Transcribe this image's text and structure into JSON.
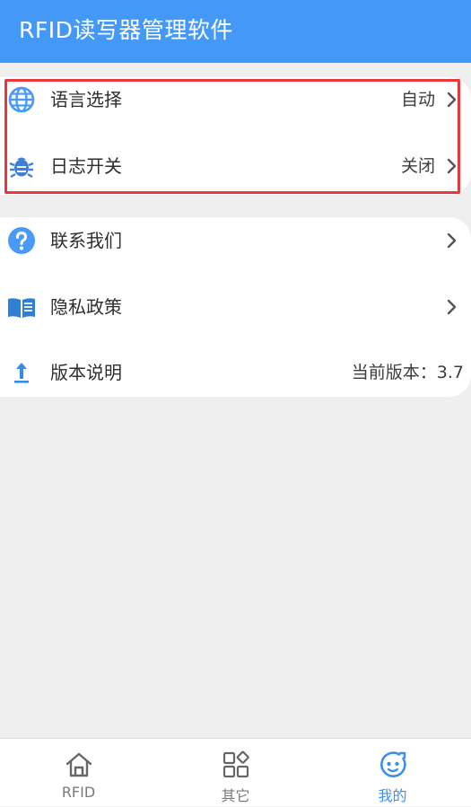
{
  "app": {
    "title": "RFID读写器管理软件"
  },
  "colors": {
    "accent": "#4499f6",
    "highlight": "#e8383d"
  },
  "settings": {
    "language": {
      "label": "语言选择",
      "value": "自动",
      "icon": "globe-icon"
    },
    "log": {
      "label": "日志开关",
      "value": "关闭",
      "icon": "bug-icon"
    }
  },
  "info": {
    "contact": {
      "label": "联系我们",
      "icon": "help-icon"
    },
    "privacy": {
      "label": "隐私政策",
      "icon": "book-icon"
    },
    "version": {
      "label": "版本说明",
      "value": "当前版本：3.7",
      "icon": "upload-arrow-icon"
    }
  },
  "tabs": [
    {
      "label": "RFID",
      "icon": "home-icon"
    },
    {
      "label": "其它",
      "icon": "grid-icon"
    },
    {
      "label": "我的",
      "icon": "face-icon",
      "active": true
    }
  ]
}
